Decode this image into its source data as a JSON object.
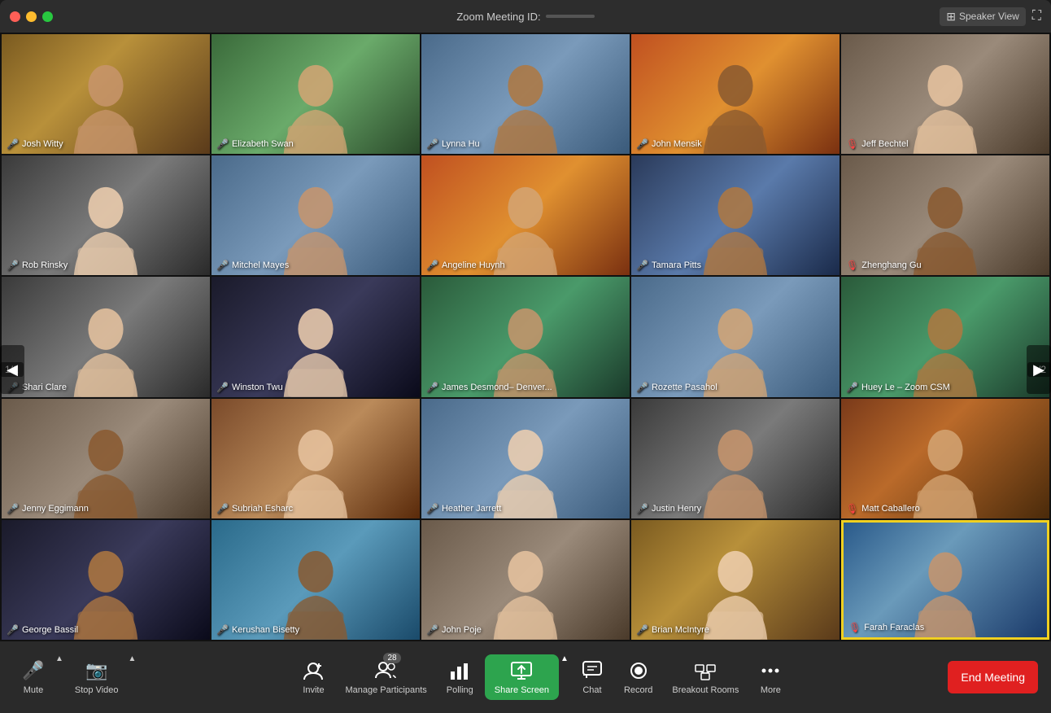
{
  "titlebar": {
    "title": "Zoom Meeting ID:",
    "speaker_view_label": "Speaker View"
  },
  "participants": [
    {
      "name": "Josh Witty",
      "bg": "bg-warm1",
      "muted": true,
      "row": 0,
      "col": 0
    },
    {
      "name": "Elizabeth Swan",
      "bg": "bg-warm2",
      "muted": true,
      "row": 0,
      "col": 1
    },
    {
      "name": "Lynna Hu",
      "bg": "bg-office1",
      "muted": true,
      "row": 0,
      "col": 2
    },
    {
      "name": "John Mensik",
      "bg": "bg-sunset",
      "muted": true,
      "row": 0,
      "col": 3
    },
    {
      "name": "Jeff Bechtel",
      "bg": "bg-office2",
      "muted": false,
      "row": 0,
      "col": 4
    },
    {
      "name": "Rob Rinsky",
      "bg": "bg-grey1",
      "muted": true,
      "row": 1,
      "col": 0
    },
    {
      "name": "Mitchel Mayes",
      "bg": "bg-office1",
      "muted": true,
      "row": 1,
      "col": 1
    },
    {
      "name": "Angeline Huynh",
      "bg": "bg-sunset",
      "muted": true,
      "row": 1,
      "col": 2
    },
    {
      "name": "Tamara Pitts",
      "bg": "bg-blue1",
      "muted": true,
      "row": 1,
      "col": 3
    },
    {
      "name": "Zhenghang Gu",
      "bg": "bg-office2",
      "muted": false,
      "row": 1,
      "col": 4
    },
    {
      "name": "Shari Clare",
      "bg": "bg-grey1",
      "muted": true,
      "row": 2,
      "col": 0
    },
    {
      "name": "Winston Twu",
      "bg": "bg-dark1",
      "muted": true,
      "row": 2,
      "col": 1
    },
    {
      "name": "James Desmond– Denver...",
      "bg": "bg-green1",
      "muted": true,
      "row": 2,
      "col": 2
    },
    {
      "name": "Rozette Pasahol",
      "bg": "bg-office1",
      "muted": true,
      "row": 2,
      "col": 3
    },
    {
      "name": "Huey Le – Zoom CSM",
      "bg": "bg-green1",
      "muted": true,
      "row": 2,
      "col": 4
    },
    {
      "name": "Jenny Eggimann",
      "bg": "bg-office2",
      "muted": true,
      "row": 3,
      "col": 0
    },
    {
      "name": "Subriah Esharc",
      "bg": "bg-warm3",
      "muted": true,
      "row": 3,
      "col": 1
    },
    {
      "name": "Heather Jarrett",
      "bg": "bg-office1",
      "muted": true,
      "row": 3,
      "col": 2
    },
    {
      "name": "Justin Henry",
      "bg": "bg-grey1",
      "muted": true,
      "row": 3,
      "col": 3
    },
    {
      "name": "Matt Caballero",
      "bg": "bg-autumn",
      "muted": false,
      "row": 3,
      "col": 4
    },
    {
      "name": "George Bassil",
      "bg": "bg-dark1",
      "muted": true,
      "row": 4,
      "col": 0
    },
    {
      "name": "Kerushan Bisetty",
      "bg": "bg-pool",
      "muted": true,
      "row": 4,
      "col": 1
    },
    {
      "name": "John Poje",
      "bg": "bg-office2",
      "muted": true,
      "row": 4,
      "col": 2
    },
    {
      "name": "Brian McIntyre",
      "bg": "bg-warm1",
      "muted": true,
      "row": 4,
      "col": 3
    },
    {
      "name": "Farah Faraclas",
      "bg": "bg-lake",
      "muted": false,
      "row": 4,
      "col": 4,
      "active": true
    }
  ],
  "toolbar": {
    "mute_label": "Mute",
    "stop_video_label": "Stop Video",
    "invite_label": "Invite",
    "manage_participants_label": "Manage Participants",
    "participants_count": "28",
    "polling_label": "Polling",
    "share_screen_label": "Share Screen",
    "chat_label": "Chat",
    "record_label": "Record",
    "breakout_rooms_label": "Breakout Rooms",
    "more_label": "More",
    "end_meeting_label": "End Meeting"
  },
  "navigation": {
    "page_indicator": "1/2"
  }
}
